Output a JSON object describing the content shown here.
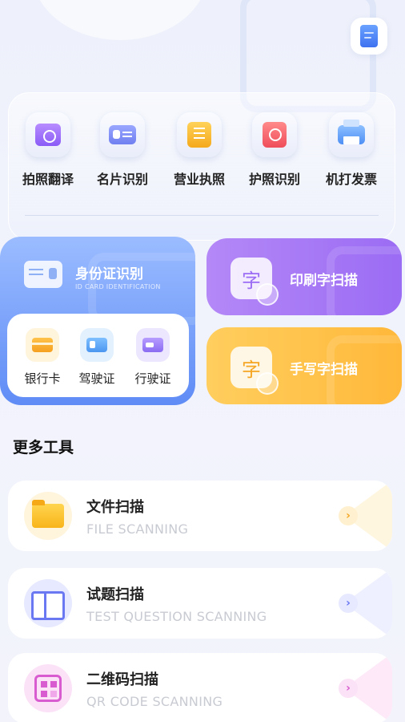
{
  "top_tools": [
    {
      "label": "拍照翻译",
      "icon": "camera-icon"
    },
    {
      "label": "名片识别",
      "icon": "business-card-icon"
    },
    {
      "label": "营业执照",
      "icon": "business-license-icon"
    },
    {
      "label": "护照识别",
      "icon": "passport-icon"
    },
    {
      "label": "机打发票",
      "icon": "printer-icon"
    }
  ],
  "id_card": {
    "title": "身份证识别",
    "subtitle": "ID CARD IDENTIFICATION",
    "items": [
      {
        "label": "银行卡",
        "icon": "bank-card-icon"
      },
      {
        "label": "驾驶证",
        "icon": "driver-license-icon"
      },
      {
        "label": "行驶证",
        "icon": "vehicle-license-icon"
      }
    ]
  },
  "scan_cards": [
    {
      "label": "印刷字扫描",
      "glyph": "字",
      "color": "#9b6cf4"
    },
    {
      "label": "手写字扫描",
      "glyph": "字",
      "color": "#ffb83a"
    }
  ],
  "more_title": "更多工具",
  "more_tools": [
    {
      "title": "文件扫描",
      "subtitle": "FILE SCANNING",
      "icon": "folder-icon"
    },
    {
      "title": "试题扫描",
      "subtitle": "TEST QUESTION SCANNING",
      "icon": "book-icon"
    },
    {
      "title": "二维码扫描",
      "subtitle": "QR CODE SCANNING",
      "icon": "qr-code-icon"
    }
  ],
  "chevron": "›",
  "colors": {
    "accent_blue": "#5f8cf6",
    "accent_purple": "#9b6cf4",
    "accent_yellow": "#ffb83a"
  }
}
